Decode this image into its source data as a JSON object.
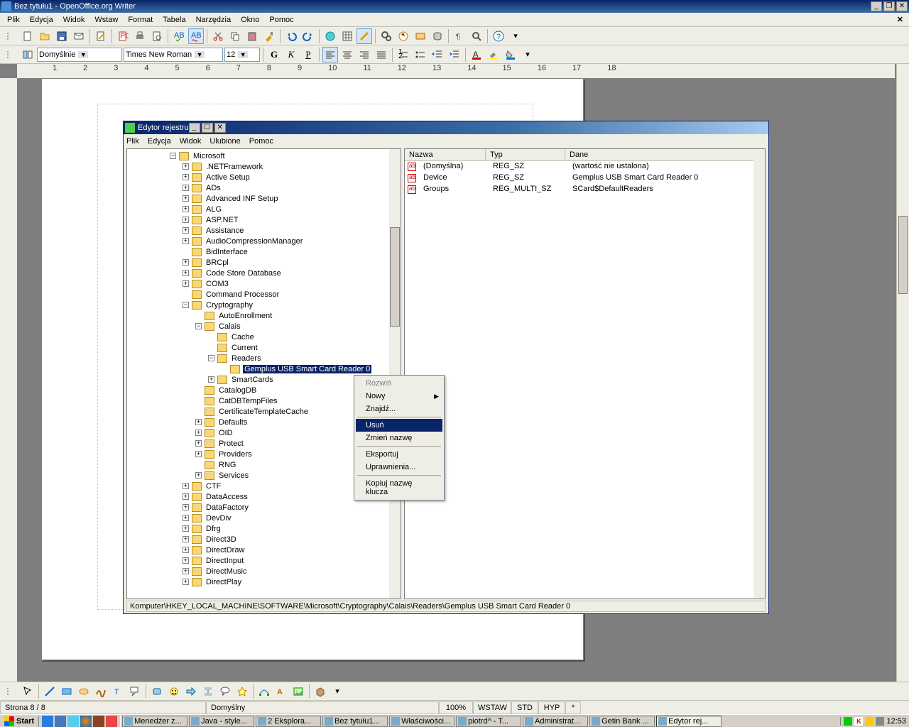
{
  "window_title": "Bez tytułu1 - OpenOffice.org Writer",
  "menu": [
    "Plik",
    "Edycja",
    "Widok",
    "Wstaw",
    "Format",
    "Tabela",
    "Narzędzia",
    "Okno",
    "Pomoc"
  ],
  "style_combo": "Domyślnie",
  "font_combo": "Times New Roman",
  "size_combo": "12",
  "ruler_nums": [
    "1",
    "2",
    "3",
    "4",
    "5",
    "6",
    "7",
    "8",
    "9",
    "10",
    "11",
    "12",
    "13",
    "14",
    "15",
    "16",
    "17",
    "18"
  ],
  "status": {
    "page": "Strona  8 / 8",
    "style": "Domyślny",
    "zoom": "100%",
    "ins": "WSTAW",
    "std": "STD",
    "hyp": "HYP",
    "dirty": "*"
  },
  "reg": {
    "title": "Edytor rejestru",
    "menu": [
      "Plik",
      "Edycja",
      "Widok",
      "Ulubione",
      "Pomoc"
    ],
    "path": "Komputer\\HKEY_LOCAL_MACHINE\\SOFTWARE\\Microsoft\\Cryptography\\Calais\\Readers\\Gemplus USB Smart Card Reader 0",
    "cols": {
      "name": "Nazwa",
      "type": "Typ",
      "data": "Dane"
    },
    "vals": [
      {
        "name": "(Domyślna)",
        "type": "REG_SZ",
        "data": "(wartość nie ustalona)"
      },
      {
        "name": "Device",
        "type": "REG_SZ",
        "data": "Gemplus USB Smart Card Reader 0"
      },
      {
        "name": "Groups",
        "type": "REG_MULTI_SZ",
        "data": "SCard$DefaultReaders"
      }
    ],
    "tree_root": "Microsoft",
    "tree1": [
      ".NETFramework",
      "Active Setup",
      "ADs",
      "Advanced INF Setup",
      "ALG",
      "ASP.NET",
      "Assistance",
      "AudioCompressionManager",
      "BidInterface",
      "BRCpl",
      "Code Store Database",
      "COM3",
      "Command Processor"
    ],
    "crypto": "Cryptography",
    "crypto_children": [
      "AutoEnrollment"
    ],
    "calais": "Calais",
    "calais1": [
      "Cache",
      "Current"
    ],
    "readers": "Readers",
    "selected": "Gemplus USB Smart Card Reader 0",
    "calais2": [
      "SmartCards"
    ],
    "crypto_after": [
      "CatalogDB",
      "CatDBTempFiles",
      "CertificateTemplateCache",
      "Defaults",
      "OID",
      "Protect",
      "Providers",
      "RNG",
      "Services"
    ],
    "tree2": [
      "CTF",
      "DataAccess",
      "DataFactory",
      "DevDiv",
      "Dfrg",
      "Direct3D",
      "DirectDraw",
      "DirectInput",
      "DirectMusic",
      "DirectPlay"
    ]
  },
  "ctx": {
    "expand": "Rozwiń",
    "new": "Nowy",
    "find": "Znajdź...",
    "delete": "Usuń",
    "rename": "Zmień nazwę",
    "export": "Eksportuj",
    "perms": "Uprawnienia...",
    "copy": "Kopiuj nazwę klucza"
  },
  "taskbar": {
    "start": "Start",
    "tasks": [
      {
        "l": "Menedżer z...",
        "a": false
      },
      {
        "l": "Java - style...",
        "a": false
      },
      {
        "l": "2 Eksplora...",
        "a": false
      },
      {
        "l": "Bez tytułu1...",
        "a": false
      },
      {
        "l": "Właściwości...",
        "a": false
      },
      {
        "l": "piotrd^ - T...",
        "a": false
      },
      {
        "l": "Administrat...",
        "a": false
      },
      {
        "l": "Getin Bank ...",
        "a": false
      },
      {
        "l": "Edytor rej...",
        "a": true
      }
    ],
    "clock": "12:53"
  }
}
